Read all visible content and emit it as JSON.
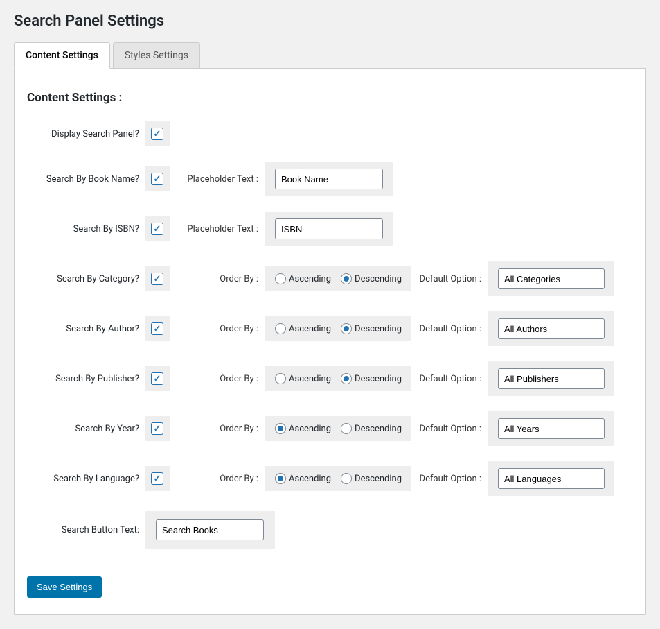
{
  "page": {
    "title": "Search Panel Settings"
  },
  "tabs": {
    "content": "Content Settings",
    "styles": "Styles Settings",
    "active": "content"
  },
  "section": {
    "title": "Content Settings :"
  },
  "labels": {
    "placeholder_text": "Placeholder Text :",
    "order_by": "Order By :",
    "default_option": "Default Option :",
    "ascending": "Ascending",
    "descending": "Descending"
  },
  "rows": {
    "display": {
      "label": "Display Search Panel?",
      "checked": true
    },
    "book_name": {
      "label": "Search By Book Name?",
      "checked": true,
      "placeholder": "Book Name"
    },
    "isbn": {
      "label": "Search By ISBN?",
      "checked": true,
      "placeholder": "ISBN"
    },
    "category": {
      "label": "Search By Category?",
      "checked": true,
      "order": "desc",
      "default": "All Categories"
    },
    "author": {
      "label": "Search By Author?",
      "checked": true,
      "order": "desc",
      "default": "All Authors"
    },
    "publisher": {
      "label": "Search By Publisher?",
      "checked": true,
      "order": "desc",
      "default": "All Publishers"
    },
    "year": {
      "label": "Search By Year?",
      "checked": true,
      "order": "asc",
      "default": "All Years"
    },
    "language": {
      "label": "Search By Language?",
      "checked": true,
      "order": "asc",
      "default": "All Languages"
    },
    "search_text": {
      "label": "Search Button Text:",
      "value": "Search Books"
    }
  },
  "actions": {
    "save": "Save Settings"
  }
}
